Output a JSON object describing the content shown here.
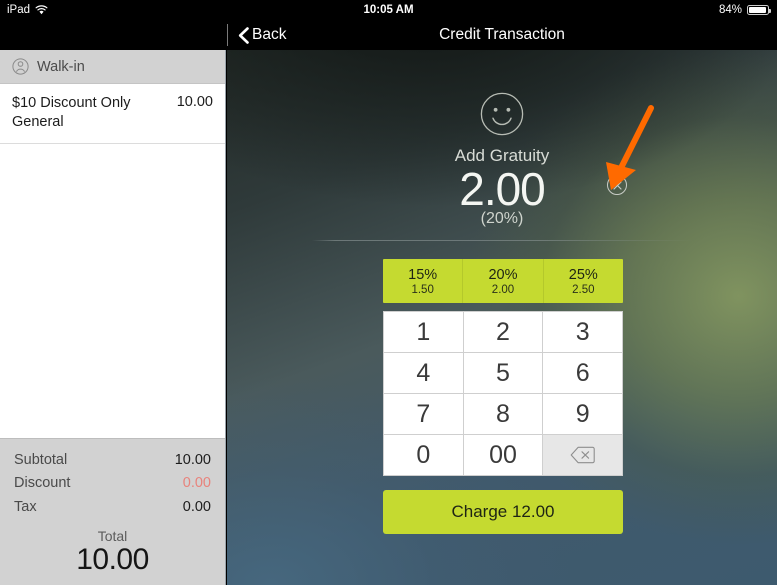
{
  "status_bar": {
    "device": "iPad",
    "wifi_icon": "wifi-icon",
    "time": "10:05 AM",
    "battery_percent": "84%",
    "battery_level": 84,
    "battery_icon": "battery-icon"
  },
  "nav": {
    "back_label": "Back",
    "back_icon": "chevron-left-icon",
    "title": "Credit Transaction"
  },
  "sidebar": {
    "customer": {
      "icon": "person-icon",
      "name": "Walk-in"
    },
    "cart_items": [
      {
        "name": "$10 Discount Only General",
        "price": "10.00"
      }
    ],
    "totals": [
      {
        "label": "Subtotal",
        "value": "10.00",
        "negative": false
      },
      {
        "label": "Discount",
        "value": "0.00",
        "negative": true
      },
      {
        "label": "Tax",
        "value": "0.00",
        "negative": false
      }
    ],
    "total_label": "Total",
    "total_value": "10.00"
  },
  "gratuity": {
    "smiley_icon": "smiley-face-icon",
    "label": "Add Gratuity",
    "amount": "2.00",
    "percent_text": "(20%)",
    "clear_icon": "clear-circle-x-icon"
  },
  "tip_options": [
    {
      "percent": "15%",
      "amount": "1.50"
    },
    {
      "percent": "20%",
      "amount": "2.00"
    },
    {
      "percent": "25%",
      "amount": "2.50"
    }
  ],
  "keypad": [
    {
      "label": "1",
      "type": "digit"
    },
    {
      "label": "2",
      "type": "digit"
    },
    {
      "label": "3",
      "type": "digit"
    },
    {
      "label": "4",
      "type": "digit"
    },
    {
      "label": "5",
      "type": "digit"
    },
    {
      "label": "6",
      "type": "digit"
    },
    {
      "label": "7",
      "type": "digit"
    },
    {
      "label": "8",
      "type": "digit"
    },
    {
      "label": "9",
      "type": "digit"
    },
    {
      "label": "0",
      "type": "digit"
    },
    {
      "label": "00",
      "type": "digit"
    },
    {
      "label": "",
      "type": "backspace",
      "icon": "backspace-icon"
    }
  ],
  "charge_button": {
    "label": "Charge 12.00"
  },
  "annotation": {
    "arrow_icon": "pointer-arrow-icon",
    "color": "#ff6a00"
  },
  "colors": {
    "accent_green": "#c5da30",
    "sidebar_gray": "#d2d2d2",
    "discount_red": "#e8837c",
    "nav_black": "#000000"
  }
}
